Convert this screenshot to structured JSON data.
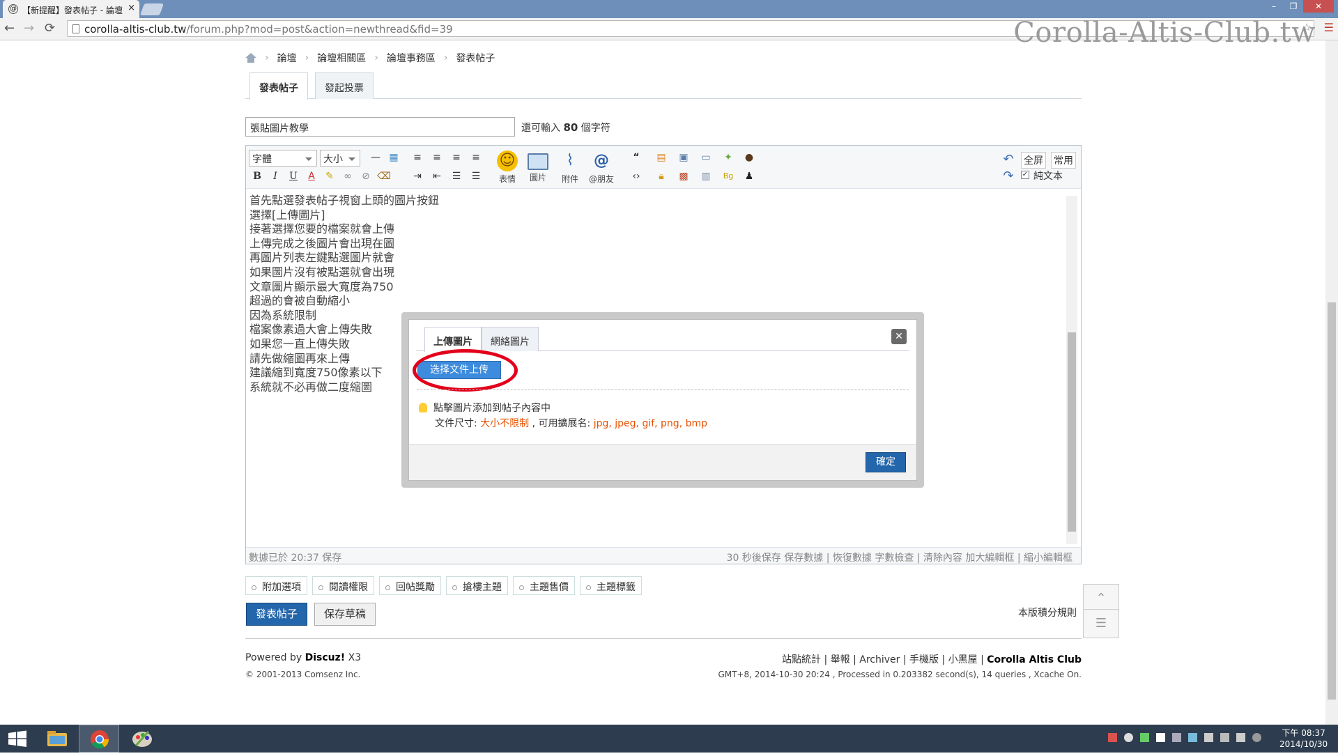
{
  "browser": {
    "tab_title": "【新提醒】發表帖子 - 論壇",
    "tab_close": "×",
    "url_host": "corolla-altis-club.tw",
    "url_path": "/forum.php?mod=post&action=newthread&fid=39",
    "watermark": "Corolla-Altis-Club.tw",
    "back_icon": "←",
    "forward_icon": "→",
    "reload_icon": "⟳",
    "window_controls": [
      "–",
      "❐",
      "✕"
    ]
  },
  "breadcrumb": [
    "論壇",
    "論壇相關區",
    "論壇事務區",
    "發表帖子"
  ],
  "post_tabs": [
    "發表帖子",
    "發起投票"
  ],
  "subject": {
    "value": "張貼圖片教學",
    "remaining_prefix": "還可輸入",
    "remaining_count": "80",
    "remaining_suffix": "個字符"
  },
  "editor": {
    "font_select": "字體",
    "size_select": "大小",
    "format_buttons": [
      "B",
      "I",
      "U",
      "A"
    ],
    "big_buttons": [
      {
        "label": "表情",
        "icon": "smiley-icon"
      },
      {
        "label": "圖片",
        "icon": "image-icon"
      },
      {
        "label": "附件",
        "icon": "paperclip-icon"
      },
      {
        "label": "@朋友",
        "icon": "at-icon"
      }
    ],
    "fullscreen": "全屏",
    "common": "常用",
    "plaintext": "純文本",
    "content": [
      "首先點選發表帖子視窗上頭的圖片按鈕",
      "",
      "",
      "選擇[上傳圖片]",
      "",
      "",
      "接著選擇您要的檔案就會上傳",
      "",
      "",
      "上傳完成之後圖片會出現在圖",
      "",
      "",
      "再圖片列表左鍵點選圖片就會",
      "如果圖片沒有被點選就會出現",
      "",
      "文章圖片顯示最大寬度為750",
      "超過的會被自動縮小",
      "",
      "因為系統限制",
      "檔案像素過大會上傳失敗",
      "如果您一直上傳失敗",
      "請先做縮圖再來上傳",
      "建議縮到寬度750像素以下",
      "系統就不必再做二度縮圖"
    ],
    "status_left": "數據已於 20:37 保存",
    "status_right": "30 秒後保存 保存數據 | 恢復數據   字數檢查 | 清除內容   加大編輯框 | 縮小編輯框"
  },
  "options": [
    "附加選項",
    "閱讀權限",
    "回帖獎勵",
    "搶樓主題",
    "主題售價",
    "主題標籤"
  ],
  "buttons": {
    "post": "發表帖子",
    "draft": "保存草稿"
  },
  "rules": "本版積分規則",
  "footer": {
    "powered_prefix": "Powered by ",
    "powered_brand": "Discuz!",
    "powered_version": " X3",
    "copyright": "© 2001-2013 Comsenz Inc.",
    "links": [
      "站點統計",
      "舉報",
      "Archiver",
      "手機版",
      "小黑屋"
    ],
    "site_name": "Corolla Altis Club",
    "info": "GMT+8, 2014-10-30 20:24 , Processed in 0.203382 second(s), 14 queries , Xcache On."
  },
  "dialog": {
    "tabs": [
      "上傳圖片",
      "網絡圖片"
    ],
    "close_icon": "✕",
    "upload_button": "选择文件上传",
    "tip": "點擊圖片添加到帖子內容中",
    "size_label": "文件尺寸: ",
    "size_value": "大小不限制",
    "ext_label": " , 可用擴展名: ",
    "ext_value": "jpg, jpeg, gif, png, bmp",
    "confirm": "確定"
  },
  "taskbar": {
    "clock_time": "下午 08:37",
    "clock_date": "2014/10/30"
  }
}
